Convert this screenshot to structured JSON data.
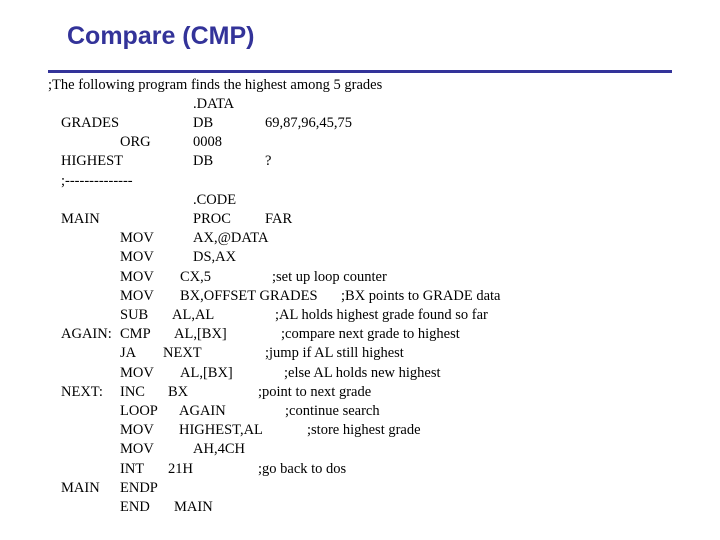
{
  "slide": {
    "title": "Compare (CMP)",
    "accent_color": "#333399"
  },
  "intro_comment": ";The following program finds the highest among 5 grades",
  "lines": [
    {
      "label": "",
      "op": ".DATA",
      "operand": "",
      "comment": ""
    },
    {
      "label": "GRADES",
      "op": "DB",
      "operand": "69,87,96,45,75",
      "comment": ""
    },
    {
      "label": "ORG",
      "op": "0008",
      "operand": "",
      "comment": ""
    },
    {
      "label": "HIGHEST",
      "op": "DB",
      "operand": "?",
      "comment": ""
    },
    {
      "label": ";--------------",
      "op": "",
      "operand": "",
      "comment": ""
    },
    {
      "label": "",
      "op": ".CODE",
      "operand": "",
      "comment": ""
    },
    {
      "label": "MAIN",
      "op": "PROC",
      "operand": "FAR",
      "comment": ""
    },
    {
      "label": "",
      "op": "MOV",
      "operand": "AX,@DATA",
      "comment": ""
    },
    {
      "label": "",
      "op": "MOV",
      "operand": "DS,AX",
      "comment": ""
    },
    {
      "label": "",
      "op": "MOV",
      "operand": "CX,5",
      "comment": ";set up loop counter"
    },
    {
      "label": "",
      "op": "MOV",
      "operand": "BX,OFFSET GRADES",
      "comment": ";BX points to GRADE data"
    },
    {
      "label": "",
      "op": "SUB",
      "operand": "AL,AL",
      "comment": ";AL holds highest grade found so far"
    },
    {
      "label": "AGAIN:",
      "op": "CMP",
      "operand": "AL,[BX]",
      "comment": ";compare next grade to highest"
    },
    {
      "label": "",
      "op": "JA",
      "operand": "NEXT",
      "comment": ";jump if AL still highest"
    },
    {
      "label": "",
      "op": "MOV",
      "operand": "AL,[BX]",
      "comment": ";else AL holds new highest"
    },
    {
      "label": "NEXT:",
      "op": "INC",
      "operand": "BX",
      "comment": ";point to next grade"
    },
    {
      "label": "",
      "op": "LOOP",
      "operand": "AGAIN",
      "comment": ";continue search"
    },
    {
      "label": "",
      "op": "MOV",
      "operand": "HIGHEST,AL",
      "comment": ";store highest grade"
    },
    {
      "label": "",
      "op": "MOV",
      "operand": "AH,4CH",
      "comment": ""
    },
    {
      "label": "",
      "op": "INT",
      "operand": "21H",
      "comment": ";go back to dos"
    },
    {
      "label": "MAIN",
      "op": "ENDP",
      "operand": "",
      "comment": ""
    },
    {
      "label": "",
      "op": "END",
      "operand": "MAIN",
      "comment": ""
    }
  ]
}
